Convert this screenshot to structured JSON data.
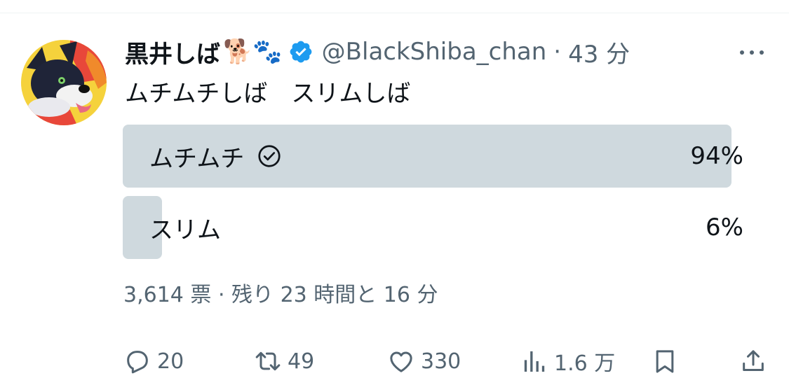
{
  "tweet": {
    "display_name": "黒井しば",
    "name_emoji": "🐕🐾",
    "handle": "@BlackShiba_chan",
    "separator": "·",
    "time": "43 分",
    "text": "ムチムチしば　スリムしば"
  },
  "poll": {
    "options": [
      {
        "label": "ムチムチ",
        "percent_text": "94%",
        "percent": 94,
        "selected": true
      },
      {
        "label": "スリム",
        "percent_text": "6%",
        "percent": 6,
        "selected": false
      }
    ],
    "meta": "3,614 票 · 残り 23 時間と 16 分"
  },
  "actions": {
    "replies": "20",
    "retweets": "49",
    "likes": "330",
    "views": "1.6 万"
  },
  "icons": [
    "verified-badge-icon",
    "more-icon",
    "check-circle-icon",
    "reply-icon",
    "retweet-icon",
    "like-icon",
    "views-icon",
    "bookmark-icon",
    "share-icon"
  ],
  "colors": {
    "verified": "#1d9bf0",
    "poll_fill": "#cfd9de",
    "muted_text": "#536471"
  }
}
